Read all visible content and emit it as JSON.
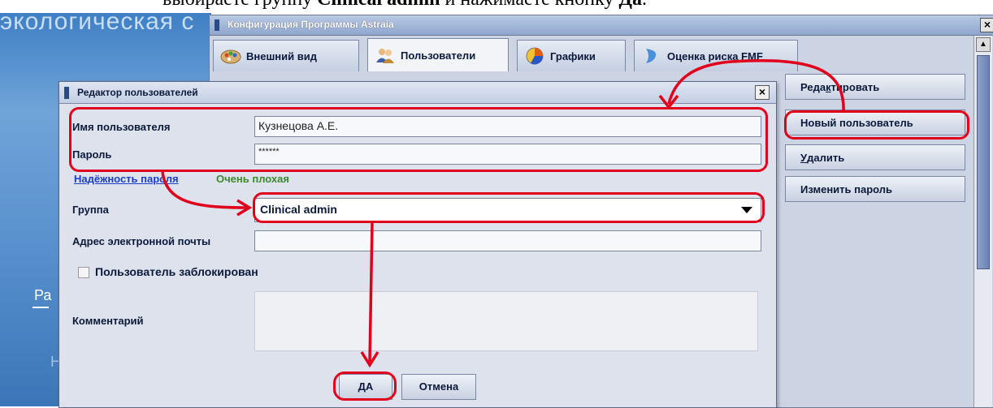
{
  "caption": {
    "part1": "выбираете группу ",
    "bold1": "Clinical admin",
    "part2": " и нажимаете кнопку ",
    "bold2": "Да"
  },
  "background_app": {
    "title": "экологическая с",
    "text1": "Ра",
    "text2": "Н"
  },
  "config_window": {
    "title": "Конфигурация Программы Astraia",
    "close_label": "×",
    "tabs": [
      {
        "label": "Внешний вид",
        "icon": "palette-icon"
      },
      {
        "label": "Пользователи",
        "icon": "users-icon"
      },
      {
        "label": "Графики",
        "icon": "chart-icon"
      },
      {
        "label": "Оценка риска FMF",
        "icon": "risk-icon"
      }
    ],
    "buttons": {
      "edit_prefix": "Реда",
      "edit_underlined": "к",
      "edit_suffix": "тировать",
      "new_user": "Новый пользователь",
      "delete_underlined": "У",
      "delete_suffix": "далить",
      "change_password": "Изменить пароль"
    },
    "scroll_up": "▲"
  },
  "user_editor": {
    "title": "Редактор пользователей",
    "close_label": "×",
    "username_label": "Имя пользователя",
    "username_value": "Кузнецова А.Е.",
    "password_label": "Пароль",
    "password_value": "******",
    "password_strength_link": "Надёжность пароля",
    "password_strength_value": "Очень плохая",
    "group_label": "Группа",
    "group_value": "Clinical admin",
    "email_label": "Адрес электронной почты",
    "email_value": "",
    "blocked_label": "Пользователь заблокирован",
    "comment_label": "Комментарий",
    "comment_value": "",
    "ok_button": "ДА",
    "cancel_button": "Отмена"
  },
  "colors": {
    "annotation_red": "#e0001c",
    "link_blue": "#1b3ec8",
    "strength_green": "#3a8a2c"
  }
}
